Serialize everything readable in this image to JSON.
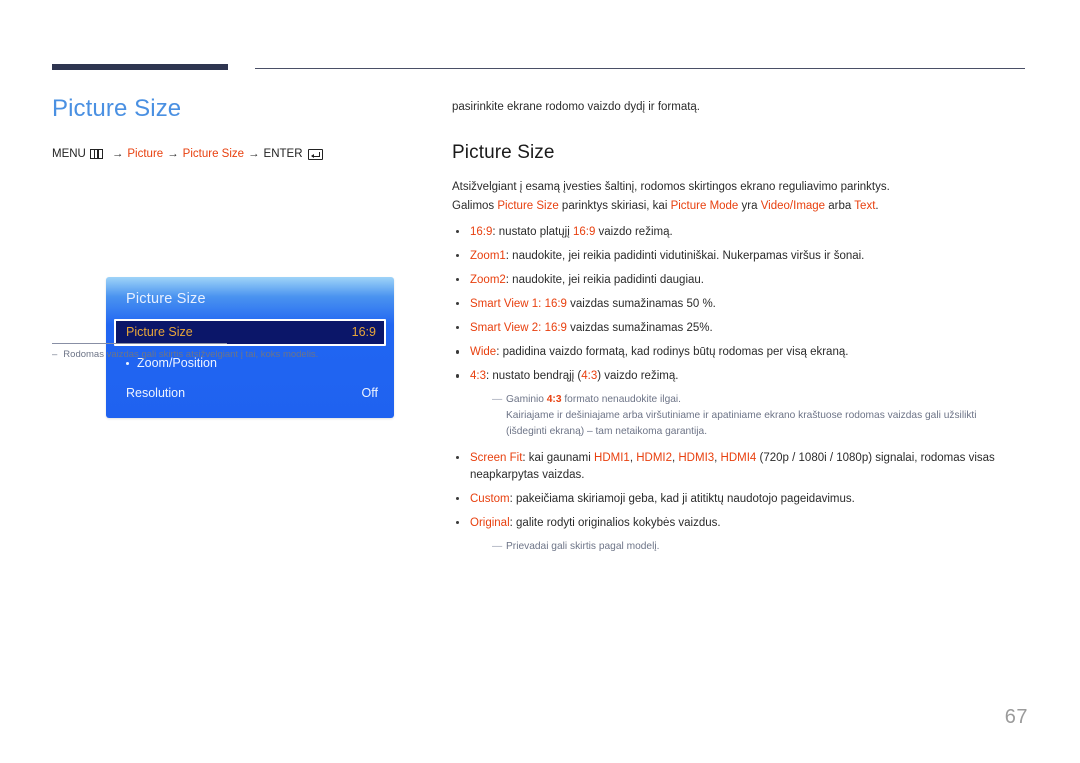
{
  "header": {
    "rule_color": "#2e3550",
    "thin_rule_color": "#4a4f66"
  },
  "left": {
    "title": "Picture Size",
    "menu_path": {
      "menu_label": "MENU",
      "menu_icon": "menu-grid-icon",
      "arrow1": "→",
      "item1": "Picture",
      "arrow2": "→",
      "item2": "Picture Size",
      "arrow3": "→",
      "enter_label": "ENTER",
      "enter_icon": "enter-return-icon"
    },
    "osd": {
      "title": "Picture Size",
      "rows": [
        {
          "label": "Picture Size",
          "value": "16:9",
          "selected": true,
          "sub": false
        },
        {
          "label": "Zoom/Position",
          "value": "",
          "selected": false,
          "sub": true
        },
        {
          "label": "Resolution",
          "value": "Off",
          "selected": false,
          "sub": false
        }
      ],
      "bg_top": "#9fd4f8",
      "bg_bottom": "#1f62f0",
      "selected_bg": "#0b1669",
      "selected_text": "#e7a53a"
    },
    "footnote": {
      "dash": "–",
      "text": "Rodomas vaizdas gali skirtis atsižvelgiant į tai, koks modelis."
    }
  },
  "right": {
    "lead": "pasirinkite ekrane rodomo vaizdo dydį ir formatą.",
    "section_title": "Picture Size",
    "paragraph1": "Atsižvelgiant į esamą įvesties šaltinį, rodomos skirtingos ekrano reguliavimo parinktys.",
    "paragraph2": {
      "t1": "Galimos ",
      "r1": "Picture Size",
      "t2": " parinktys skiriasi, kai ",
      "r2": "Picture Mode",
      "t3": " yra ",
      "r3": "Video/Image",
      "t4": " arba ",
      "r4": "Text",
      "t5": "."
    },
    "bullets": [
      {
        "term": "16:9",
        "t1": ": nustato platųjį ",
        "r1": "16:9",
        "t2": " vaizdo režimą."
      },
      {
        "term": "Zoom1",
        "t1": ": naudokite, jei reikia padidinti vidutiniškai. Nukerpamas viršus ir šonai."
      },
      {
        "term": "Zoom2",
        "t1": ": naudokite, jei reikia padidinti daugiau."
      },
      {
        "term": "Smart View 1: 16:9",
        "t1": " vaizdas sumažinamas 50 %."
      },
      {
        "term": "Smart View 2: 16:9",
        "t1": " vaizdas sumažinamas 25%."
      },
      {
        "term": "Wide",
        "t1": ": padidina vaizdo formatą, kad rodinys būtų rodomas per visą ekraną."
      },
      {
        "term": "4:3",
        "t1": ": nustato bendrąjį (",
        "r1": "4:3",
        "t2": ") vaizdo režimą."
      }
    ],
    "note_43": {
      "dash": "—",
      "line1_a": "Gaminio ",
      "line1_red": "4:3",
      "line1_b": " formato nenaudokite ilgai.",
      "line2": "Kairiajame ir dešiniajame arba viršutiniame ir apatiniame ekrano kraštuose rodomas vaizdas gali užsilikti",
      "line3": "(išdeginti ekraną) – tam netaikoma garantija."
    },
    "bullets2": [
      {
        "term": "Screen Fit",
        "t1": ": kai gaunami ",
        "reds": [
          "HDMI1",
          "HDMI2",
          "HDMI3",
          "HDMI4"
        ],
        "t2": " (720p / 1080i / 1080p) signalai, rodomas visas",
        "t3": "neapkarpytas vaizdas."
      },
      {
        "term": "Custom",
        "t1": ": pakeičiama skiriamoji geba, kad ji atitiktų naudotojo pageidavimus."
      },
      {
        "term": "Original",
        "t1": ": galite rodyti originalios kokybės vaizdus."
      }
    ],
    "note_ports": {
      "dash": "—",
      "text": "Prievadai gali skirtis pagal modelį."
    }
  },
  "page_number": "67"
}
